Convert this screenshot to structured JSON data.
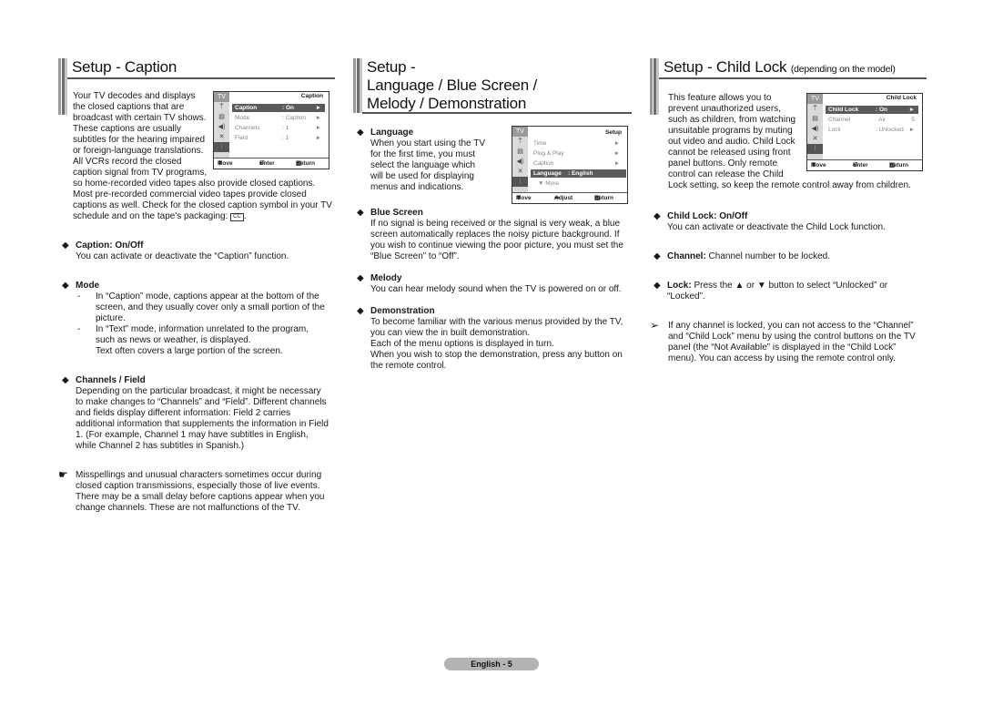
{
  "columns": {
    "caption": {
      "title": "Setup - Caption",
      "intro_lines": [
        "Your TV decodes and displays",
        "the closed captions that are",
        "broadcast with certain TV shows.",
        "These captions are usually",
        "subtitles for the hearing impaired",
        "or foreign-language translations.",
        "All VCRs record the closed",
        "caption signal from TV programs,"
      ],
      "intro_rest": "so home-recorded video tapes also provide closed captions. Most pre-recorded commercial video tapes provide closed captions as well. Check for the closed caption symbol in your TV schedule and on the tape's packaging:",
      "cc_symbol": "CC",
      "intro_end": ".",
      "osd": {
        "tv_label": "TV",
        "title": "Caption",
        "rows": [
          {
            "label": "Caption",
            "value": ": On",
            "arrow": "►",
            "highlighted": true
          },
          {
            "label": "Mode",
            "value": ": Caption",
            "arrow": "►",
            "highlighted": false
          },
          {
            "label": "Channels",
            "value": ": 1",
            "arrow": "►",
            "highlighted": false
          },
          {
            "label": "Field",
            "value": ": 1",
            "arrow": "►",
            "highlighted": false
          }
        ],
        "footer": {
          "move": "Move",
          "enter": "Enter",
          "return": "Return"
        }
      },
      "sections": [
        {
          "title": "Caption: On/Off",
          "body": "You can activate or deactivate the “Caption” function."
        },
        {
          "title": "Mode",
          "dash_items": [
            "In “Caption” mode, captions appear at the bottom of the screen, and they usually cover only a small portion of the picture.",
            "In “Text” mode, information unrelated to the program, such as news or weather, is displayed."
          ],
          "extra": "Text often covers a large portion of the screen."
        },
        {
          "title": "Channels / Field",
          "body": "Depending on the particular broadcast, it might be necessary to make changes to “Channels” and “Field”. Different channels and fields display different information: Field 2 carries additional information that supplements the information in Field 1. (For example, Channel 1 may have subtitles in English, while Channel 2 has subtitles in Spanish.)"
        }
      ],
      "note": "Misspellings and unusual characters sometimes occur during closed caption transmissions, especially those of live events. There may be a small delay before captions appear when you change channels. These are not malfunctions of the TV."
    },
    "language": {
      "title_lines": [
        "Setup -",
        "Language / Blue Screen /",
        "Melody / Demonstration"
      ],
      "osd": {
        "tv_label": "TV",
        "title": "Setup",
        "rows": [
          {
            "label": "Time",
            "value": "",
            "arrow": "►",
            "highlighted": false
          },
          {
            "label": "Plug & Play",
            "value": "",
            "arrow": "►",
            "highlighted": false
          },
          {
            "label": "Caption",
            "value": "",
            "arrow": "►",
            "highlighted": false
          },
          {
            "label": "Language",
            "value": ": English",
            "arrow": "",
            "highlighted": true
          },
          {
            "label": "▼ More",
            "value": "",
            "arrow": "",
            "highlighted": false
          }
        ],
        "footer": {
          "move": "Move",
          "adjust": "Adjust",
          "return": "Return"
        }
      },
      "sections": [
        {
          "title": "Language",
          "body_lines": [
            "When you start using the TV",
            "for the first time, you must",
            "select the language which",
            "will be used for displaying",
            "menus and indications."
          ]
        },
        {
          "title": "Blue Screen",
          "body": "If no signal is being received or the signal is very weak, a blue screen automatically replaces the noisy picture background. If you wish to continue viewing the poor picture, you must set the “Blue Screen” to “Off”."
        },
        {
          "title": "Melody",
          "body": "You can hear melody sound when the TV is powered on or off."
        },
        {
          "title": "Demonstration",
          "body_lines": [
            "To become familiar with the various menus provided by the TV, you can view the in built demonstration.",
            "Each of the menu options is displayed in turn.",
            "When you wish to stop the demonstration, press any button on the remote control."
          ]
        }
      ]
    },
    "childlock": {
      "title": "Setup - Child Lock",
      "title_sub": "(depending on the model)",
      "intro_lines": [
        "This feature allows you to",
        "prevent unauthorized users,",
        "such as children, from watching",
        "unsuitable programs by muting",
        "out video and audio. Child Lock",
        "cannot be released using front",
        "panel buttons. Only remote",
        "control can release the Child"
      ],
      "intro_rest": "Lock setting, so keep the remote control away from children.",
      "osd": {
        "tv_label": "TV",
        "title": "Child Lock",
        "rows": [
          {
            "label": "Child Lock",
            "value": ": On",
            "arrow": "►",
            "highlighted": true
          },
          {
            "label": "Channel",
            "value": ": Air",
            "arrow": "5",
            "highlighted": false
          },
          {
            "label": "Lock",
            "value": ": Unlocked",
            "arrow": "►",
            "highlighted": false
          }
        ],
        "footer": {
          "move": "Move",
          "enter": "Enter",
          "return": "Return"
        }
      },
      "sections": [
        {
          "title": "Child Lock: On/Off",
          "body": "You can activate or deactivate the Child Lock function."
        },
        {
          "title": "Channel:",
          "body": " Channel number to be locked."
        },
        {
          "title": "Lock:",
          "body": " Press the ▲ or ▼ button to select “Unlocked” or “Locked”."
        }
      ],
      "note": "If any channel is locked, you can not access to the “Channel” and “Child Lock” menu by using the control buttons on the TV panel (the “Not Available” is displayed in the “Child Lock” menu). You can access by using the remote control only."
    }
  },
  "icons": {
    "bullet": "◆",
    "pointing_hand": "☛",
    "arrow_note": "➢",
    "move": "⬍",
    "enter": "⏎",
    "adjust": "⬌",
    "return": "▥",
    "antenna": "⍑",
    "picture": "▤",
    "sound": "◀)",
    "channel": "✕",
    "setup": "⫶"
  },
  "footer": {
    "page_label": "English - 5"
  }
}
